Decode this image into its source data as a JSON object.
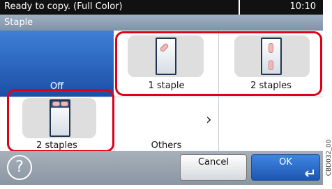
{
  "status_bar": {
    "message": "Ready to copy. (Full Color)",
    "time": "10:10"
  },
  "title": "Staple",
  "options": {
    "off": {
      "label": "Off",
      "selected": true
    },
    "one_staple": {
      "label": "1 staple",
      "icon": "one-staple-icon"
    },
    "two_staples_side": {
      "label": "2 staples",
      "icon": "two-staples-side-icon"
    },
    "two_staples_top": {
      "label": "2 staples",
      "icon": "two-staples-top-icon"
    },
    "others": {
      "label": "Others",
      "icon": "chevron-right-icon"
    }
  },
  "footer": {
    "help_icon": "help-icon",
    "help_symbol": "?",
    "cancel_label": "Cancel",
    "ok_label": "OK",
    "ok_icon": "enter-icon"
  },
  "side_code": "CBD032_00",
  "colors": {
    "accent_blue": "#1b4fa8",
    "highlight_red": "#e00016"
  }
}
